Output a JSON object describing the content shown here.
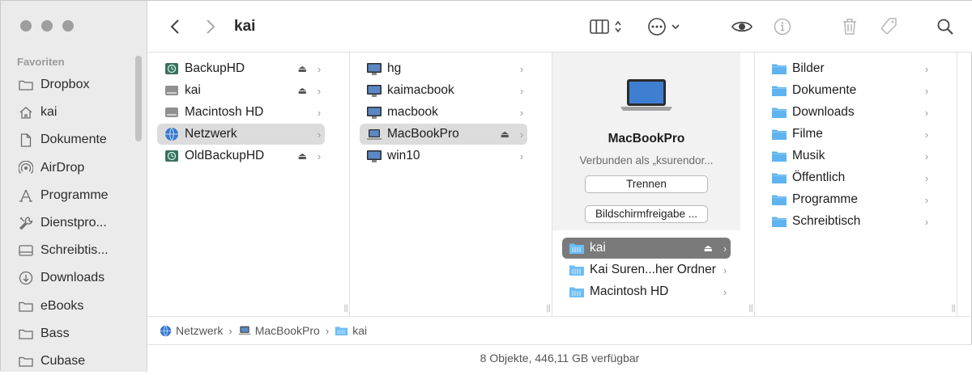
{
  "sidebar": {
    "heading": "Favoriten",
    "items": [
      {
        "label": "Dropbox",
        "icon": "folder-icon"
      },
      {
        "label": "kai",
        "icon": "home-icon"
      },
      {
        "label": "Dokumente",
        "icon": "document-icon"
      },
      {
        "label": "AirDrop",
        "icon": "airdrop-icon"
      },
      {
        "label": "Programme",
        "icon": "applications-icon"
      },
      {
        "label": "Dienstpro...",
        "icon": "tools-icon"
      },
      {
        "label": "Schreibtis...",
        "icon": "desktop-icon"
      },
      {
        "label": "Downloads",
        "icon": "download-icon"
      },
      {
        "label": "eBooks",
        "icon": "folder-icon"
      },
      {
        "label": "Bass",
        "icon": "folder-icon"
      },
      {
        "label": "Cubase",
        "icon": "folder-icon"
      }
    ]
  },
  "toolbar": {
    "title": "kai"
  },
  "columns": {
    "col1": [
      {
        "name": "BackupHD",
        "eject": true
      },
      {
        "name": "kai",
        "eject": true
      },
      {
        "name": "Macintosh HD",
        "eject": false
      },
      {
        "name": "Netzwerk",
        "eject": false,
        "selected": true
      },
      {
        "name": "OldBackupHD",
        "eject": true
      }
    ],
    "col2": [
      {
        "name": "hg"
      },
      {
        "name": "kaimacbook"
      },
      {
        "name": "macbook"
      },
      {
        "name": "MacBookPro",
        "selected": true
      },
      {
        "name": "win10"
      }
    ],
    "col3": {
      "preview_name": "MacBookPro",
      "preview_sub": "Verbunden als „ksurendor...",
      "disconnect_label": "Trennen",
      "screenshare_label": "Bildschirmfreigabe ...",
      "items": [
        {
          "name": "kai",
          "eject": true,
          "selected": true
        },
        {
          "name": "Kai Suren...her Ordner"
        },
        {
          "name": "Macintosh HD"
        }
      ]
    },
    "col4": [
      {
        "name": "Bilder"
      },
      {
        "name": "Dokumente"
      },
      {
        "name": "Downloads"
      },
      {
        "name": "Filme"
      },
      {
        "name": "Musik"
      },
      {
        "name": "Öffentlich"
      },
      {
        "name": "Programme"
      },
      {
        "name": "Schreibtisch"
      }
    ]
  },
  "pathbar": {
    "items": [
      "Netzwerk",
      "MacBookPro",
      "kai"
    ]
  },
  "status": {
    "text": "8 Objekte, 446,11 GB verfügbar"
  },
  "colors": {
    "folder_blue": "#5fb4f0",
    "selection_grey": "#dcdcdc",
    "selection_dark": "#7a7a7a"
  }
}
